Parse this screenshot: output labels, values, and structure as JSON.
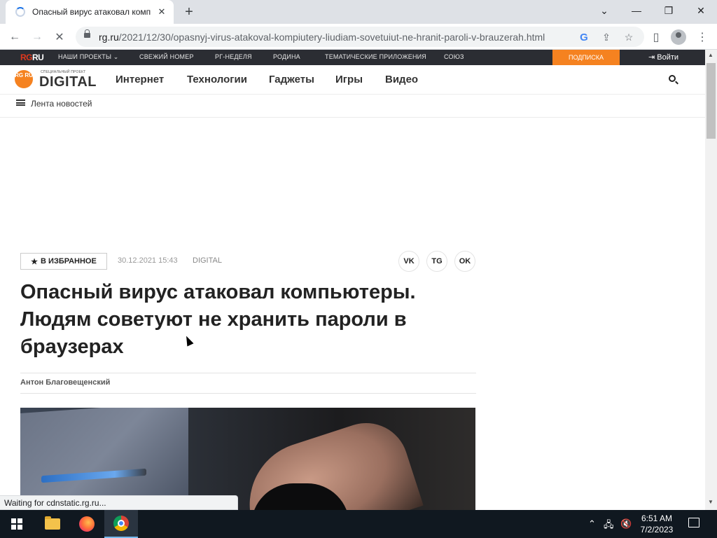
{
  "browser": {
    "tab_title": "Опасный вирус атаковал компьют",
    "url_host": "rg.ru",
    "url_path": "/2021/12/30/opasnyj-virus-atakoval-kompiutery-liudiam-sovetuiut-ne-hranit-paroli-v-brauzerah.html",
    "status_text": "Waiting for cdnstatic.rg.ru..."
  },
  "site": {
    "top_logo_a": "RG",
    "top_logo_b": "RU",
    "top_links": [
      "НАШИ ПРОЕКТЫ ⌄",
      "СВЕЖИЙ НОМЕР",
      "РГ-НЕДЕЛЯ",
      "РОДИНА",
      "ТЕМАТИЧЕСКИЕ ПРИЛОЖЕНИЯ",
      "СОЮЗ"
    ],
    "subscribe": "ПОДПИСКА",
    "login": "Войти",
    "logo_badge": "RG RU",
    "logo_small": "СПЕЦИАЛЬНЫЙ ПРОЕКТ",
    "logo_main": "DIGITAL",
    "nav": [
      "Интернет",
      "Технологии",
      "Гаджеты",
      "Игры",
      "Видео"
    ],
    "feed_label": "Лента новостей"
  },
  "article": {
    "favorite": "В ИЗБРАННОЕ",
    "date": "30.12.2021 15:43",
    "rubric": "DIGITAL",
    "share": [
      "VK",
      "TG",
      "OK"
    ],
    "title": "Опасный вирус атаковал компьютеры. Людям советуют не хранить пароли в браузерах",
    "author": "Антон Благовещенский"
  },
  "taskbar": {
    "time": "6:51 AM",
    "date": "7/2/2023"
  },
  "colors": {
    "accent_orange": "#f58220",
    "topbar_dark": "#2b2d33"
  }
}
